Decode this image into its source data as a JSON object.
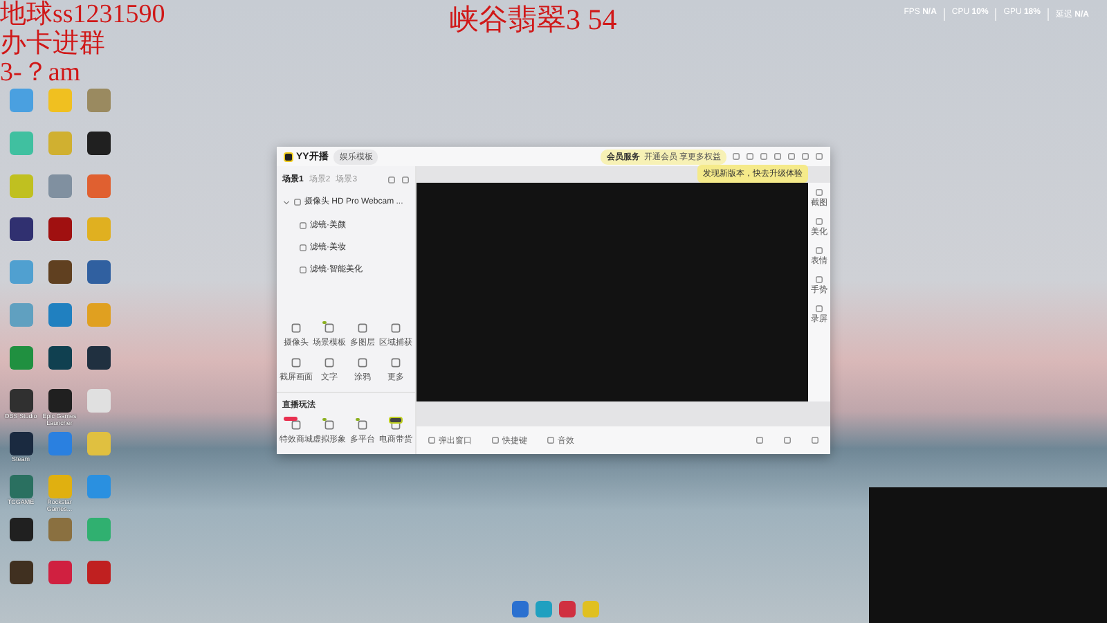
{
  "overlay": {
    "lines": [
      "地球ss1231590",
      "办卡进群",
      "3-？am"
    ],
    "title": "峡谷翡翠3 54"
  },
  "stats": [
    {
      "name": "FPS",
      "value": "N/A"
    },
    {
      "name": "CPU",
      "value": "10%"
    },
    {
      "name": "GPU",
      "value": "18%"
    },
    {
      "name": "延迟",
      "value": "N/A"
    }
  ],
  "desktop_icons": [
    {
      "color": "#4aa0e0"
    },
    {
      "color": "#f0c020"
    },
    {
      "color": "#9a8a60"
    },
    {
      "color": "#40c0a0"
    },
    {
      "color": "#d0b030"
    },
    {
      "color": "#202020"
    },
    {
      "color": "#c0c020"
    },
    {
      "color": "#8090a0"
    },
    {
      "color": "#e06030"
    },
    {
      "color": "#303070"
    },
    {
      "color": "#a01010"
    },
    {
      "color": "#e0b020"
    },
    {
      "color": "#50a0d0"
    },
    {
      "color": "#604020"
    },
    {
      "color": "#3060a0"
    },
    {
      "color": "#60a0c0"
    },
    {
      "color": "#2080c0"
    },
    {
      "color": "#e0a020"
    },
    {
      "color": "#209040"
    },
    {
      "color": "#104050"
    },
    {
      "color": "#203040"
    },
    {
      "color": "#303030",
      "label": "OBS Studio"
    },
    {
      "color": "#202020",
      "label": "Epic Games Launcher"
    },
    {
      "color": "#e0e0e0"
    },
    {
      "color": "#1a2a40",
      "label": "Steam"
    },
    {
      "color": "#2a80e0"
    },
    {
      "color": "#e0c040"
    },
    {
      "color": "#2a7060",
      "label": "TCGAME"
    },
    {
      "color": "#e0b010",
      "label": "Rockstar Games..."
    },
    {
      "color": "#2a90e0"
    },
    {
      "color": "#202020"
    },
    {
      "color": "#8a7040"
    },
    {
      "color": "#30b070"
    },
    {
      "color": "#403020"
    },
    {
      "color": "#d02040"
    },
    {
      "color": "#c02020"
    }
  ],
  "app": {
    "logo": "YY开播",
    "mode": "娱乐模板",
    "banner": {
      "badge": "会员服务",
      "text": "开通会员 享更多权益"
    },
    "tooltip": "发现新版本，快去升级体验",
    "scene_tabs": [
      {
        "label": "场景1",
        "selected": true
      },
      {
        "label": "场景2",
        "selected": false
      },
      {
        "label": "场景3",
        "selected": false
      }
    ],
    "source": {
      "label": "摄像头 HD Pro Webcam ...",
      "expanded": true,
      "children": [
        {
          "label": "滤镜·美颜"
        },
        {
          "label": "滤镜·美妆"
        },
        {
          "label": "滤镜·智能美化"
        }
      ]
    },
    "tools": [
      {
        "label": "摄像头",
        "new": false
      },
      {
        "label": "场景模板",
        "new": true
      },
      {
        "label": "多图层",
        "new": false
      },
      {
        "label": "区域捕获",
        "new": false
      },
      {
        "label": "截屏画面",
        "new": false
      },
      {
        "label": "文字",
        "new": false
      },
      {
        "label": "涂鸦",
        "new": false
      },
      {
        "label": "更多",
        "new": false
      }
    ],
    "play_title": "直播玩法",
    "play_tools": [
      {
        "label": "特效商城",
        "kind": "new"
      },
      {
        "label": "虚拟形象",
        "kind": "dot"
      },
      {
        "label": "多平台",
        "kind": "dot"
      },
      {
        "label": "电商带货",
        "kind": "tag"
      }
    ],
    "side_tools": [
      "截图",
      "美化",
      "表情",
      "手势",
      "录屏"
    ],
    "bottom": [
      "弹出窗口",
      "快捷键",
      "音效"
    ]
  },
  "taskbar": [
    {
      "color": "#2a70d0"
    },
    {
      "color": "#20a0c0"
    },
    {
      "color": "#d03040"
    },
    {
      "color": "#e0c020"
    }
  ]
}
